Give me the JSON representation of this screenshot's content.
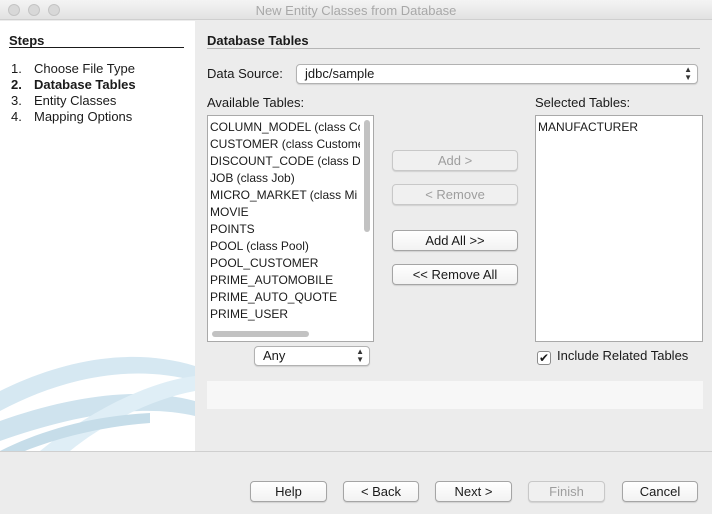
{
  "window": {
    "title": "New Entity Classes from Database"
  },
  "steps": {
    "heading": "Steps",
    "items": [
      {
        "num": "1.",
        "label": "Choose File Type"
      },
      {
        "num": "2.",
        "label": "Database Tables"
      },
      {
        "num": "3.",
        "label": "Entity Classes"
      },
      {
        "num": "4.",
        "label": "Mapping Options"
      }
    ],
    "current": 1
  },
  "main": {
    "heading": "Database Tables",
    "data_source_label": "Data Source:",
    "data_source_value": "jdbc/sample",
    "available_label": "Available Tables:",
    "selected_label": "Selected Tables:",
    "available_tables": [
      "COLUMN_MODEL (class Co",
      "CUSTOMER (class Custome",
      "DISCOUNT_CODE (class D",
      "JOB (class Job)",
      "MICRO_MARKET (class Mi",
      "MOVIE",
      "POINTS",
      "POOL (class Pool)",
      "POOL_CUSTOMER",
      "PRIME_AUTOMOBILE",
      "PRIME_AUTO_QUOTE",
      "PRIME_USER"
    ],
    "selected_tables": [
      "MANUFACTURER"
    ],
    "filter_value": "Any",
    "include_related_label": "Include Related Tables",
    "include_related_checked": true,
    "buttons": {
      "add": "Add >",
      "remove": "< Remove",
      "add_all": "Add All >>",
      "remove_all": "<< Remove All"
    }
  },
  "footer": {
    "help": "Help",
    "back": "< Back",
    "next": "Next >",
    "finish": "Finish",
    "cancel": "Cancel"
  }
}
